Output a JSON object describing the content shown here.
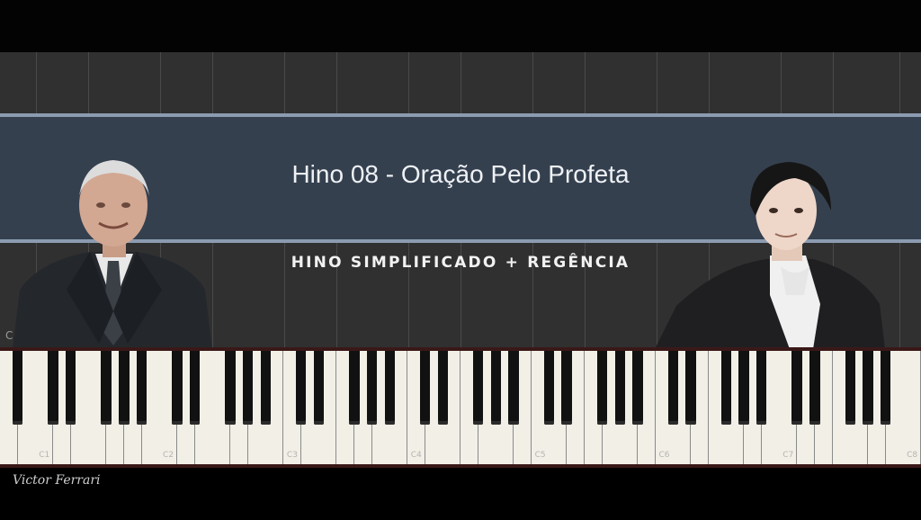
{
  "title": "Hino 08 - Oração Pelo Profeta",
  "subtitle": "HINO SIMPLIFICADO + REGÊNCIA",
  "stray_letter": "C",
  "signature": "Victor Ferrari",
  "keyboard": {
    "octave_labels": [
      "C1",
      "C2",
      "C3",
      "C4",
      "C5",
      "C6",
      "C7",
      "C8"
    ]
  },
  "colors": {
    "band": "#35404f",
    "band_rule": "#8c9bb0",
    "roll": "#303030",
    "white_key": "#f1efe6",
    "black_key": "#111111"
  },
  "icons": {
    "left_portrait": "man-portrait-icon",
    "right_portrait": "man-portrait-icon"
  }
}
